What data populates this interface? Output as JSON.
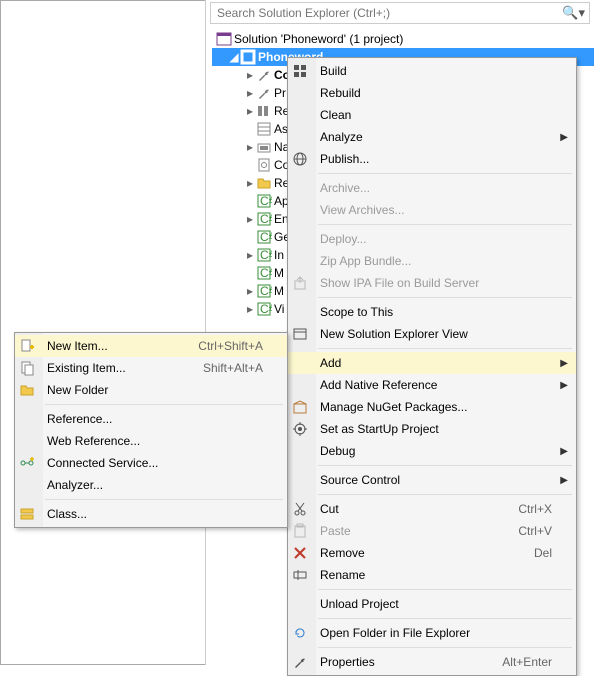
{
  "search": {
    "placeholder": "Search Solution Explorer (Ctrl+;)"
  },
  "tree": {
    "solution": "Solution 'Phoneword' (1 project)",
    "project": "Phoneword",
    "items": [
      {
        "label": "Co",
        "exp": "▸",
        "bold": true
      },
      {
        "label": "Pr",
        "exp": "▸"
      },
      {
        "label": "Re",
        "exp": "▸"
      },
      {
        "label": "As",
        "exp": ""
      },
      {
        "label": "Na",
        "exp": "▸"
      },
      {
        "label": "Co",
        "exp": ""
      },
      {
        "label": "Re",
        "exp": "▸"
      },
      {
        "label": "Ap",
        "exp": ""
      },
      {
        "label": "En",
        "exp": "▸"
      },
      {
        "label": "Ge",
        "exp": ""
      },
      {
        "label": "In",
        "exp": "▸"
      },
      {
        "label": "M",
        "exp": ""
      },
      {
        "label": "M",
        "exp": "▸"
      },
      {
        "label": "Vi",
        "exp": "▸"
      }
    ]
  },
  "mainmenu": {
    "items": [
      {
        "label": "Build",
        "icon": "build"
      },
      {
        "label": "Rebuild"
      },
      {
        "label": "Clean"
      },
      {
        "label": "Analyze",
        "sub": true
      },
      {
        "label": "Publish...",
        "icon": "globe"
      },
      {
        "sep": true
      },
      {
        "label": "Archive...",
        "disabled": true
      },
      {
        "label": "View Archives...",
        "disabled": true
      },
      {
        "sep": true
      },
      {
        "label": "Deploy...",
        "disabled": true
      },
      {
        "label": "Zip App Bundle...",
        "disabled": true
      },
      {
        "label": "Show IPA File on Build Server",
        "icon": "ipa",
        "disabled": true,
        "dicon": true
      },
      {
        "sep": true
      },
      {
        "label": "Scope to This"
      },
      {
        "label": "New Solution Explorer View",
        "icon": "window"
      },
      {
        "sep": true
      },
      {
        "label": "Add",
        "sub": true,
        "hl": true
      },
      {
        "label": "Add Native Reference",
        "sub": true
      },
      {
        "label": "Manage NuGet Packages...",
        "icon": "nuget"
      },
      {
        "label": "Set as StartUp Project",
        "icon": "star"
      },
      {
        "label": "Debug",
        "sub": true
      },
      {
        "sep": true
      },
      {
        "label": "Source Control",
        "sub": true
      },
      {
        "sep": true
      },
      {
        "label": "Cut",
        "icon": "cut",
        "short": "Ctrl+X"
      },
      {
        "label": "Paste",
        "icon": "paste",
        "disabled": true,
        "dicon": true,
        "short": "Ctrl+V"
      },
      {
        "label": "Remove",
        "icon": "remove",
        "short": "Del"
      },
      {
        "label": "Rename",
        "icon": "rename"
      },
      {
        "sep": true
      },
      {
        "label": "Unload Project"
      },
      {
        "sep": true
      },
      {
        "label": "Open Folder in File Explorer",
        "icon": "refresh"
      },
      {
        "sep": true
      },
      {
        "label": "Properties",
        "icon": "wrench",
        "short": "Alt+Enter"
      }
    ]
  },
  "submenu": {
    "items": [
      {
        "label": "New Item...",
        "icon": "newitem",
        "short": "Ctrl+Shift+A",
        "hl": true
      },
      {
        "label": "Existing Item...",
        "icon": "existing",
        "short": "Shift+Alt+A"
      },
      {
        "label": "New Folder",
        "icon": "folder"
      },
      {
        "sep": true
      },
      {
        "label": "Reference..."
      },
      {
        "label": "Web Reference..."
      },
      {
        "label": "Connected Service...",
        "icon": "connected"
      },
      {
        "label": "Analyzer..."
      },
      {
        "sep": true
      },
      {
        "label": "Class...",
        "icon": "class"
      }
    ]
  }
}
